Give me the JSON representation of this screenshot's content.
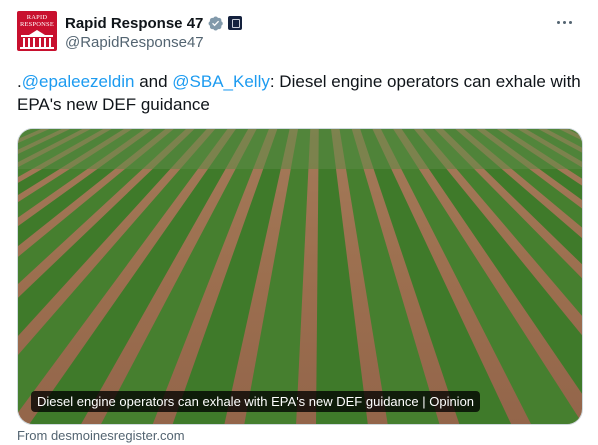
{
  "author": {
    "display_name": "Rapid Response 47",
    "handle": "@RapidResponse47",
    "avatar_text": "RAPID RESPONSE"
  },
  "tweet": {
    "prefix": ".",
    "mention_1": "@epaleezeldin",
    "joiner": " and ",
    "mention_2": "@SBA_Kelly",
    "body": ": Diesel engine operators can exhale with EPA's new DEF guidance"
  },
  "card": {
    "caption": "Diesel engine operators can exhale with EPA's new DEF guidance | Opinion",
    "source": "From desmoinesregister.com",
    "image_description_icon": "crop-field-image"
  },
  "icons": {
    "verified": "verified-badge-icon",
    "affiliation": "affiliation-badge-icon",
    "more": "more-options-icon"
  },
  "colors": {
    "link": "#1d9bf0",
    "avatar_bg": "#c8102e",
    "verified_badge": "#829aab",
    "soil": "#9a6b4b",
    "crop": "#3f7a2a"
  }
}
